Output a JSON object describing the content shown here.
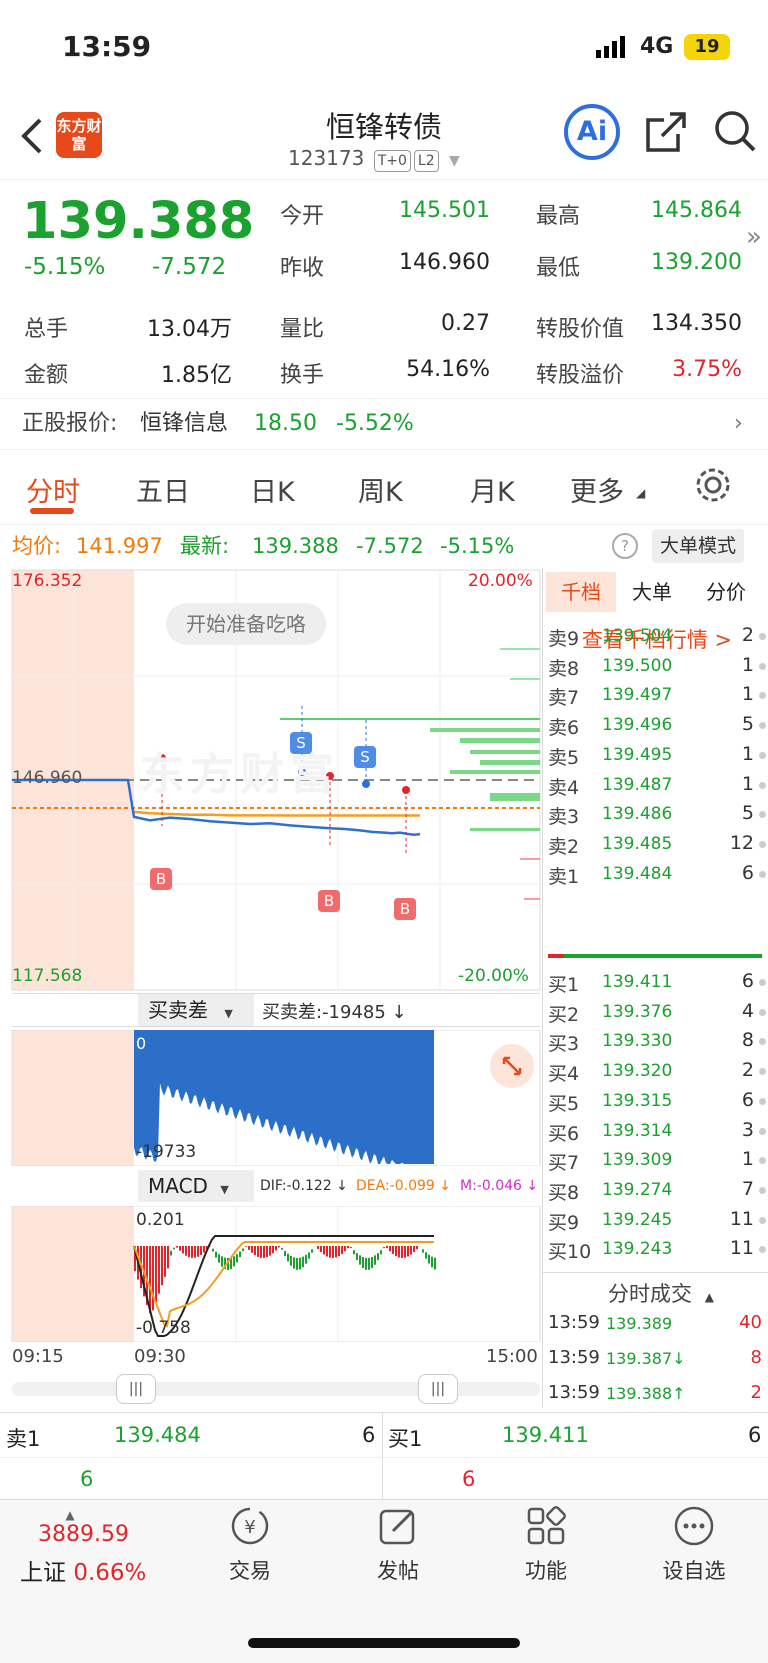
{
  "status": {
    "time": "13:59",
    "network": "4G",
    "battery": "19"
  },
  "header": {
    "title": "恒锋转债",
    "code": "123173",
    "tags": [
      "T+0",
      "L2"
    ],
    "logo": "东方财富",
    "ai": "Ai"
  },
  "quote": {
    "price": "139.388",
    "pct": "-5.15%",
    "chg": "-7.572",
    "open_label": "今开",
    "open": "145.501",
    "high_label": "最高",
    "high": "145.864",
    "prev_label": "昨收",
    "prev": "146.960",
    "low_label": "最低",
    "low": "139.200",
    "vol_label": "总手",
    "vol": "13.04万",
    "ratio_label": "量比",
    "ratio": "0.27",
    "conv_label": "转股价值",
    "conv": "134.350",
    "amt_label": "金额",
    "amt": "1.85亿",
    "turn_label": "换手",
    "turn": "54.16%",
    "prem_label": "转股溢价",
    "prem": "3.75%"
  },
  "stock": {
    "label": "正股报价:",
    "name": "恒锋信息",
    "price": "18.50",
    "pct": "-5.52%"
  },
  "tabs": [
    "分时",
    "五日",
    "日K",
    "周K",
    "月K",
    "更多"
  ],
  "info": {
    "avg_label": "均价:",
    "avg": "141.997",
    "last_label": "最新:",
    "last": "139.388",
    "chg": "-7.572",
    "pct": "-5.15%",
    "mode": "大单模式"
  },
  "chart": {
    "ymax": "176.352",
    "ymin": "117.568",
    "pmax": "20.00%",
    "pmin": "-20.00%",
    "ref": "146.960",
    "bubble": "开始准备吃咯",
    "watermark": "东方财富",
    "marks": {
      "s": "S",
      "b": "B"
    },
    "vol_selector": "买卖差",
    "vol_info": "买卖差:-19485 ↓",
    "vol_top": "0",
    "vol_bottom": "-19733",
    "macd_selector": "MACD",
    "dif": "DIF:-0.122 ↓",
    "dea": "DEA:-0.099 ↓",
    "m": "M:-0.046 ↓",
    "macd_top": "0.201",
    "macd_bottom": "-0.758",
    "times": [
      "09:15",
      "09:30",
      "15:00"
    ]
  },
  "chart_data": {
    "type": "line",
    "price": [
      146.96,
      146.96,
      146.96,
      146.96,
      146.96,
      141.8,
      141.3,
      141.7,
      141.5,
      141.2,
      141.0,
      140.8,
      140.9,
      140.6,
      140.4,
      140.2,
      140.1,
      139.9,
      139.7,
      139.6,
      139.5,
      139.6,
      139.4,
      139.3,
      139.388
    ],
    "avg_price": [
      146.96,
      146.96,
      146.96,
      146.96,
      146.96,
      142.5,
      142.3,
      142.2,
      142.1,
      142.1,
      142.0,
      142.0,
      142.0,
      141.99,
      141.99,
      141.99,
      141.998,
      141.997,
      141.997,
      141.997,
      141.997,
      141.997,
      141.997,
      141.997,
      141.997
    ]
  },
  "orderbook": {
    "tabs": [
      "千档",
      "大单",
      "分价"
    ],
    "link": "查看千档行情 >",
    "asks": [
      [
        "卖9",
        "139.504",
        "2"
      ],
      [
        "卖8",
        "139.500",
        "1"
      ],
      [
        "卖7",
        "139.497",
        "1"
      ],
      [
        "卖6",
        "139.496",
        "5"
      ],
      [
        "卖5",
        "139.495",
        "1"
      ],
      [
        "卖4",
        "139.487",
        "1"
      ],
      [
        "卖3",
        "139.486",
        "5"
      ],
      [
        "卖2",
        "139.485",
        "12"
      ],
      [
        "卖1",
        "139.484",
        "6"
      ]
    ],
    "bids": [
      [
        "买1",
        "139.411",
        "6"
      ],
      [
        "买2",
        "139.376",
        "4"
      ],
      [
        "买3",
        "139.330",
        "8"
      ],
      [
        "买4",
        "139.320",
        "2"
      ],
      [
        "买5",
        "139.315",
        "6"
      ],
      [
        "买6",
        "139.314",
        "3"
      ],
      [
        "买7",
        "139.309",
        "1"
      ],
      [
        "买8",
        "139.274",
        "7"
      ],
      [
        "买9",
        "139.245",
        "11"
      ],
      [
        "买10",
        "139.243",
        "11"
      ]
    ],
    "trades_title": "分时成交",
    "trades": [
      [
        "13:59",
        "139.389",
        "40",
        ""
      ],
      [
        "13:59",
        "139.387↓",
        "8",
        ""
      ],
      [
        "13:59",
        "139.388↑",
        "2",
        ""
      ]
    ]
  },
  "bottom": {
    "ask_label": "卖1",
    "ask_price": "139.484",
    "ask_vol": "6",
    "bid_label": "买1",
    "bid_price": "139.411",
    "bid_vol": "6",
    "ask_sub": "6",
    "bid_sub": "6"
  },
  "nav": {
    "index_value": "3889.59",
    "index_name": "上证",
    "index_pct": "0.66%",
    "items": [
      "交易",
      "发帖",
      "功能",
      "设自选"
    ]
  }
}
